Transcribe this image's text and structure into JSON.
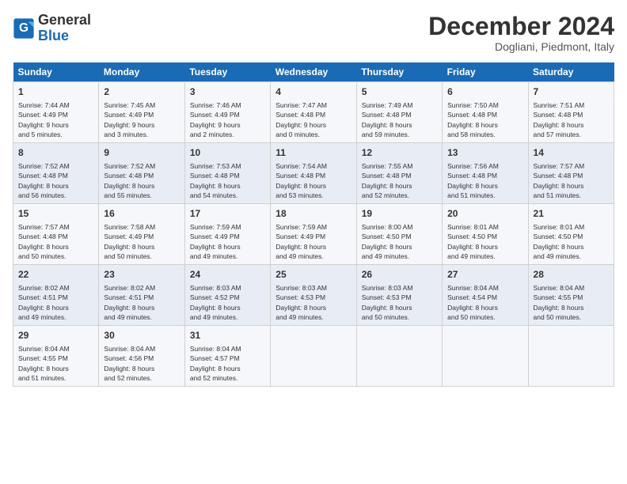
{
  "logo": {
    "line1": "General",
    "line2": "Blue"
  },
  "title": "December 2024",
  "location": "Dogliani, Piedmont, Italy",
  "headers": [
    "Sunday",
    "Monday",
    "Tuesday",
    "Wednesday",
    "Thursday",
    "Friday",
    "Saturday"
  ],
  "weeks": [
    [
      {
        "day": "1",
        "info": "Sunrise: 7:44 AM\nSunset: 4:49 PM\nDaylight: 9 hours\nand 5 minutes."
      },
      {
        "day": "2",
        "info": "Sunrise: 7:45 AM\nSunset: 4:49 PM\nDaylight: 9 hours\nand 3 minutes."
      },
      {
        "day": "3",
        "info": "Sunrise: 7:46 AM\nSunset: 4:49 PM\nDaylight: 9 hours\nand 2 minutes."
      },
      {
        "day": "4",
        "info": "Sunrise: 7:47 AM\nSunset: 4:48 PM\nDaylight: 9 hours\nand 0 minutes."
      },
      {
        "day": "5",
        "info": "Sunrise: 7:49 AM\nSunset: 4:48 PM\nDaylight: 8 hours\nand 59 minutes."
      },
      {
        "day": "6",
        "info": "Sunrise: 7:50 AM\nSunset: 4:48 PM\nDaylight: 8 hours\nand 58 minutes."
      },
      {
        "day": "7",
        "info": "Sunrise: 7:51 AM\nSunset: 4:48 PM\nDaylight: 8 hours\nand 57 minutes."
      }
    ],
    [
      {
        "day": "8",
        "info": "Sunrise: 7:52 AM\nSunset: 4:48 PM\nDaylight: 8 hours\nand 56 minutes."
      },
      {
        "day": "9",
        "info": "Sunrise: 7:52 AM\nSunset: 4:48 PM\nDaylight: 8 hours\nand 55 minutes."
      },
      {
        "day": "10",
        "info": "Sunrise: 7:53 AM\nSunset: 4:48 PM\nDaylight: 8 hours\nand 54 minutes."
      },
      {
        "day": "11",
        "info": "Sunrise: 7:54 AM\nSunset: 4:48 PM\nDaylight: 8 hours\nand 53 minutes."
      },
      {
        "day": "12",
        "info": "Sunrise: 7:55 AM\nSunset: 4:48 PM\nDaylight: 8 hours\nand 52 minutes."
      },
      {
        "day": "13",
        "info": "Sunrise: 7:56 AM\nSunset: 4:48 PM\nDaylight: 8 hours\nand 51 minutes."
      },
      {
        "day": "14",
        "info": "Sunrise: 7:57 AM\nSunset: 4:48 PM\nDaylight: 8 hours\nand 51 minutes."
      }
    ],
    [
      {
        "day": "15",
        "info": "Sunrise: 7:57 AM\nSunset: 4:48 PM\nDaylight: 8 hours\nand 50 minutes."
      },
      {
        "day": "16",
        "info": "Sunrise: 7:58 AM\nSunset: 4:49 PM\nDaylight: 8 hours\nand 50 minutes."
      },
      {
        "day": "17",
        "info": "Sunrise: 7:59 AM\nSunset: 4:49 PM\nDaylight: 8 hours\nand 49 minutes."
      },
      {
        "day": "18",
        "info": "Sunrise: 7:59 AM\nSunset: 4:49 PM\nDaylight: 8 hours\nand 49 minutes."
      },
      {
        "day": "19",
        "info": "Sunrise: 8:00 AM\nSunset: 4:50 PM\nDaylight: 8 hours\nand 49 minutes."
      },
      {
        "day": "20",
        "info": "Sunrise: 8:01 AM\nSunset: 4:50 PM\nDaylight: 8 hours\nand 49 minutes."
      },
      {
        "day": "21",
        "info": "Sunrise: 8:01 AM\nSunset: 4:50 PM\nDaylight: 8 hours\nand 49 minutes."
      }
    ],
    [
      {
        "day": "22",
        "info": "Sunrise: 8:02 AM\nSunset: 4:51 PM\nDaylight: 8 hours\nand 49 minutes."
      },
      {
        "day": "23",
        "info": "Sunrise: 8:02 AM\nSunset: 4:51 PM\nDaylight: 8 hours\nand 49 minutes."
      },
      {
        "day": "24",
        "info": "Sunrise: 8:03 AM\nSunset: 4:52 PM\nDaylight: 8 hours\nand 49 minutes."
      },
      {
        "day": "25",
        "info": "Sunrise: 8:03 AM\nSunset: 4:53 PM\nDaylight: 8 hours\nand 49 minutes."
      },
      {
        "day": "26",
        "info": "Sunrise: 8:03 AM\nSunset: 4:53 PM\nDaylight: 8 hours\nand 50 minutes."
      },
      {
        "day": "27",
        "info": "Sunrise: 8:04 AM\nSunset: 4:54 PM\nDaylight: 8 hours\nand 50 minutes."
      },
      {
        "day": "28",
        "info": "Sunrise: 8:04 AM\nSunset: 4:55 PM\nDaylight: 8 hours\nand 50 minutes."
      }
    ],
    [
      {
        "day": "29",
        "info": "Sunrise: 8:04 AM\nSunset: 4:55 PM\nDaylight: 8 hours\nand 51 minutes."
      },
      {
        "day": "30",
        "info": "Sunrise: 8:04 AM\nSunset: 4:56 PM\nDaylight: 8 hours\nand 52 minutes."
      },
      {
        "day": "31",
        "info": "Sunrise: 8:04 AM\nSunset: 4:57 PM\nDaylight: 8 hours\nand 52 minutes."
      },
      {
        "day": "",
        "info": ""
      },
      {
        "day": "",
        "info": ""
      },
      {
        "day": "",
        "info": ""
      },
      {
        "day": "",
        "info": ""
      }
    ]
  ]
}
